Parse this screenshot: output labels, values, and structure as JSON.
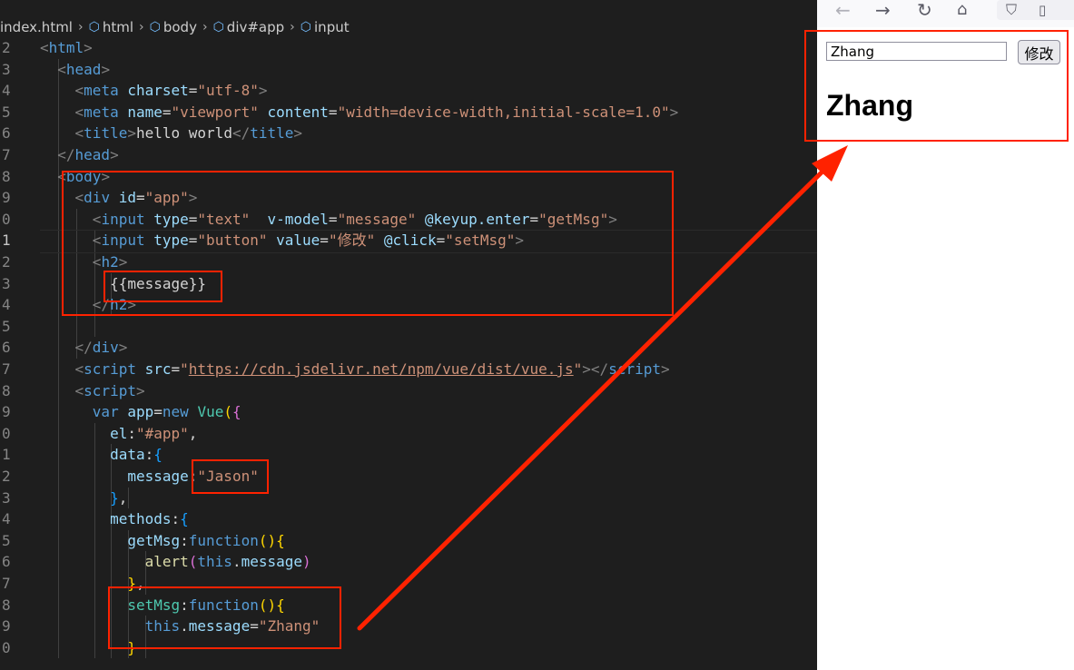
{
  "breadcrumb": {
    "file": "index.html",
    "crumbs": [
      "html",
      "body",
      "div#app",
      "input"
    ]
  },
  "editor": {
    "lines": [
      {
        "num": "2",
        "tokens": [
          [
            "k-punc",
            "<"
          ],
          [
            "k-tag",
            "html"
          ],
          [
            "k-punc",
            ">"
          ]
        ]
      },
      {
        "num": "3",
        "tokens": [
          [
            "k-text",
            "  "
          ],
          [
            "k-punc",
            "<"
          ],
          [
            "k-tag",
            "head"
          ],
          [
            "k-punc",
            ">"
          ]
        ]
      },
      {
        "num": "4",
        "tokens": [
          [
            "k-text",
            "    "
          ],
          [
            "k-punc",
            "<"
          ],
          [
            "k-tag",
            "meta"
          ],
          [
            "k-text",
            " "
          ],
          [
            "k-attr",
            "charset"
          ],
          [
            "k-text",
            "="
          ],
          [
            "k-str",
            "\"utf-8\""
          ],
          [
            "k-punc",
            ">"
          ]
        ]
      },
      {
        "num": "5",
        "tokens": [
          [
            "k-text",
            "    "
          ],
          [
            "k-punc",
            "<"
          ],
          [
            "k-tag",
            "meta"
          ],
          [
            "k-text",
            " "
          ],
          [
            "k-attr",
            "name"
          ],
          [
            "k-text",
            "="
          ],
          [
            "k-str",
            "\"viewport\""
          ],
          [
            "k-text",
            " "
          ],
          [
            "k-attr",
            "content"
          ],
          [
            "k-text",
            "="
          ],
          [
            "k-str",
            "\"width=device-width,initial-scale=1.0\""
          ],
          [
            "k-punc",
            ">"
          ]
        ]
      },
      {
        "num": "6",
        "tokens": [
          [
            "k-text",
            "    "
          ],
          [
            "k-punc",
            "<"
          ],
          [
            "k-tag",
            "title"
          ],
          [
            "k-punc",
            ">"
          ],
          [
            "k-text",
            "hello world"
          ],
          [
            "k-punc",
            "</"
          ],
          [
            "k-tag",
            "title"
          ],
          [
            "k-punc",
            ">"
          ]
        ]
      },
      {
        "num": "7",
        "tokens": [
          [
            "k-text",
            "  "
          ],
          [
            "k-punc",
            "</"
          ],
          [
            "k-tag",
            "head"
          ],
          [
            "k-punc",
            ">"
          ]
        ]
      },
      {
        "num": "8",
        "tokens": [
          [
            "k-text",
            "  "
          ],
          [
            "k-punc",
            "<"
          ],
          [
            "k-tag",
            "body"
          ],
          [
            "k-punc",
            ">"
          ]
        ]
      },
      {
        "num": "9",
        "tokens": [
          [
            "k-text",
            "    "
          ],
          [
            "k-punc",
            "<"
          ],
          [
            "k-tag",
            "div"
          ],
          [
            "k-text",
            " "
          ],
          [
            "k-attr",
            "id"
          ],
          [
            "k-text",
            "="
          ],
          [
            "k-str",
            "\"app\""
          ],
          [
            "k-punc",
            ">"
          ]
        ]
      },
      {
        "num": "0",
        "tokens": [
          [
            "k-text",
            "      "
          ],
          [
            "k-punc",
            "<"
          ],
          [
            "k-tag",
            "input"
          ],
          [
            "k-text",
            " "
          ],
          [
            "k-attr",
            "type"
          ],
          [
            "k-text",
            "="
          ],
          [
            "k-str",
            "\"text\""
          ],
          [
            "k-text",
            "  "
          ],
          [
            "k-attr",
            "v-model"
          ],
          [
            "k-text",
            "="
          ],
          [
            "k-str",
            "\"message\""
          ],
          [
            "k-text",
            " "
          ],
          [
            "k-attr",
            "@keyup.enter"
          ],
          [
            "k-text",
            "="
          ],
          [
            "k-str",
            "\"getMsg\""
          ],
          [
            "k-punc",
            ">"
          ]
        ]
      },
      {
        "num": "1",
        "current": true,
        "tokens": [
          [
            "k-text",
            "      "
          ],
          [
            "k-punc",
            "<"
          ],
          [
            "k-tag",
            "input"
          ],
          [
            "k-text",
            " "
          ],
          [
            "k-attr",
            "type"
          ],
          [
            "k-text",
            "="
          ],
          [
            "k-str",
            "\"button\""
          ],
          [
            "k-text",
            " "
          ],
          [
            "k-attr",
            "value"
          ],
          [
            "k-text",
            "="
          ],
          [
            "k-str",
            "\"修改\""
          ],
          [
            "k-text",
            " "
          ],
          [
            "k-attr",
            "@click"
          ],
          [
            "k-text",
            "="
          ],
          [
            "k-str",
            "\"setMsg\""
          ],
          [
            "k-punc",
            ">"
          ]
        ]
      },
      {
        "num": "2",
        "tokens": [
          [
            "k-text",
            "      "
          ],
          [
            "k-punc",
            "<"
          ],
          [
            "k-tag",
            "h2"
          ],
          [
            "k-punc",
            ">"
          ]
        ]
      },
      {
        "num": "3",
        "tokens": [
          [
            "k-text",
            "        "
          ],
          [
            "k-text",
            "{{message}}"
          ]
        ]
      },
      {
        "num": "4",
        "tokens": [
          [
            "k-text",
            "      "
          ],
          [
            "k-punc",
            "</"
          ],
          [
            "k-tag",
            "h2"
          ],
          [
            "k-punc",
            ">"
          ]
        ]
      },
      {
        "num": "5",
        "tokens": [
          [
            "k-text",
            ""
          ]
        ]
      },
      {
        "num": "6",
        "tokens": [
          [
            "k-text",
            "    "
          ],
          [
            "k-punc",
            "</"
          ],
          [
            "k-tag",
            "div"
          ],
          [
            "k-punc",
            ">"
          ]
        ]
      },
      {
        "num": "7",
        "tokens": [
          [
            "k-text",
            "    "
          ],
          [
            "k-punc",
            "<"
          ],
          [
            "k-tag",
            "script"
          ],
          [
            "k-text",
            " "
          ],
          [
            "k-attr",
            "src"
          ],
          [
            "k-text",
            "="
          ],
          [
            "k-str",
            "\""
          ],
          [
            "k-url",
            "https://cdn.jsdelivr.net/npm/vue/dist/vue.js"
          ],
          [
            "k-str",
            "\""
          ],
          [
            "k-punc",
            "></"
          ],
          [
            "k-tag",
            "script"
          ],
          [
            "k-punc",
            ">"
          ]
        ]
      },
      {
        "num": "8",
        "tokens": [
          [
            "k-text",
            "    "
          ],
          [
            "k-punc",
            "<"
          ],
          [
            "k-tag",
            "script"
          ],
          [
            "k-punc",
            ">"
          ]
        ]
      },
      {
        "num": "9",
        "tokens": [
          [
            "k-text",
            "      "
          ],
          [
            "k-kw",
            "var"
          ],
          [
            "k-text",
            " "
          ],
          [
            "k-prop",
            "app"
          ],
          [
            "k-text",
            "="
          ],
          [
            "k-kw",
            "new"
          ],
          [
            "k-text",
            " "
          ],
          [
            "k-cls",
            "Vue"
          ],
          [
            "k-brace1",
            "("
          ],
          [
            "k-brace2",
            "{"
          ]
        ]
      },
      {
        "num": "0",
        "tokens": [
          [
            "k-text",
            "        "
          ],
          [
            "k-key",
            "el"
          ],
          [
            "k-text",
            ":"
          ],
          [
            "k-str",
            "\"#app\""
          ],
          [
            "k-text",
            ","
          ]
        ]
      },
      {
        "num": "1",
        "tokens": [
          [
            "k-text",
            "        "
          ],
          [
            "k-key",
            "data"
          ],
          [
            "k-text",
            ":"
          ],
          [
            "k-brace3",
            "{"
          ]
        ]
      },
      {
        "num": "2",
        "tokens": [
          [
            "k-text",
            "          "
          ],
          [
            "k-key",
            "message"
          ],
          [
            "k-text",
            ":"
          ],
          [
            "k-str",
            "\"Jason\""
          ]
        ]
      },
      {
        "num": "3",
        "tokens": [
          [
            "k-text",
            "        "
          ],
          [
            "k-brace3",
            "}"
          ],
          [
            "k-text",
            ","
          ]
        ]
      },
      {
        "num": "4",
        "tokens": [
          [
            "k-text",
            "        "
          ],
          [
            "k-key",
            "methods"
          ],
          [
            "k-text",
            ":"
          ],
          [
            "k-brace3",
            "{"
          ]
        ]
      },
      {
        "num": "5",
        "tokens": [
          [
            "k-text",
            "          "
          ],
          [
            "k-key",
            "getMsg"
          ],
          [
            "k-text",
            ":"
          ],
          [
            "k-kw",
            "function"
          ],
          [
            "k-brace1",
            "()"
          ],
          [
            "k-brace1",
            "{"
          ]
        ]
      },
      {
        "num": "6",
        "tokens": [
          [
            "k-text",
            "            "
          ],
          [
            "k-fn",
            "alert"
          ],
          [
            "k-brace2",
            "("
          ],
          [
            "k-this",
            "this"
          ],
          [
            "k-text",
            "."
          ],
          [
            "k-prop",
            "message"
          ],
          [
            "k-brace2",
            ")"
          ]
        ]
      },
      {
        "num": "7",
        "tokens": [
          [
            "k-text",
            "          "
          ],
          [
            "k-brace1",
            "}"
          ],
          [
            "k-text",
            ","
          ]
        ]
      },
      {
        "num": "8",
        "tokens": [
          [
            "k-text",
            "          "
          ],
          [
            "k-method",
            "setMsg"
          ],
          [
            "k-text",
            ":"
          ],
          [
            "k-kw",
            "function"
          ],
          [
            "k-brace1",
            "()"
          ],
          [
            "k-brace1",
            "{"
          ]
        ]
      },
      {
        "num": "9",
        "tokens": [
          [
            "k-text",
            "            "
          ],
          [
            "k-this",
            "this"
          ],
          [
            "k-text",
            "."
          ],
          [
            "k-prop",
            "message"
          ],
          [
            "k-text",
            "="
          ],
          [
            "k-str",
            "\"Zhang\""
          ]
        ]
      },
      {
        "num": "0",
        "tokens": [
          [
            "k-text",
            "          "
          ],
          [
            "k-brace1",
            "}"
          ]
        ]
      }
    ]
  },
  "browser": {
    "input_value": "Zhang",
    "button_label": "修改",
    "heading": "Zhang"
  },
  "colors": {
    "annotation": "#ff2200",
    "editor_bg": "#1e1e1e",
    "browser_bg": "#ffffff"
  }
}
